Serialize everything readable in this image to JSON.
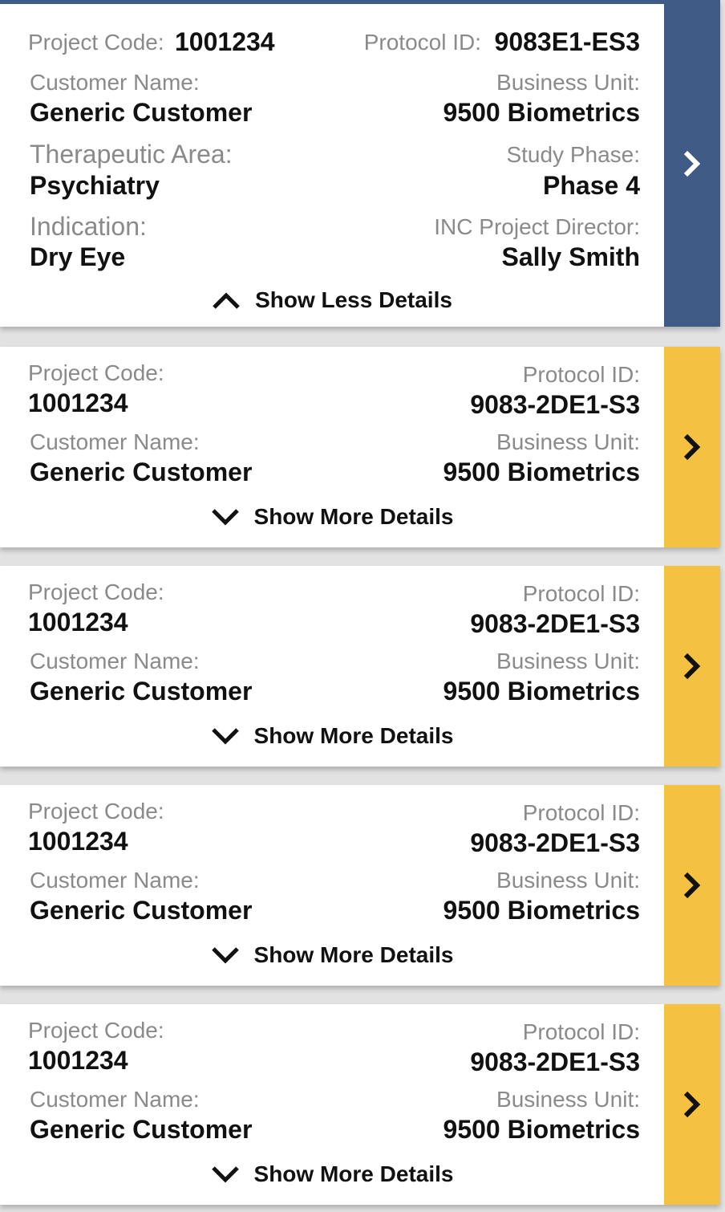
{
  "colors": {
    "expanded_accent": "#3f5a85",
    "collapsed_accent": "#f4c140"
  },
  "icons": {
    "open": "chevron-right-icon",
    "collapse": "chevron-up-icon",
    "expand": "chevron-down-icon"
  },
  "expanded_card": {
    "project_code_label": "Project Code:",
    "project_code": "1001234",
    "protocol_id_label": "Protocol ID:",
    "protocol_id": "9083E1-ES3",
    "customer_name_label": "Customer Name:",
    "customer_name": "Generic Customer",
    "business_unit_label": "Business Unit:",
    "business_unit": "9500 Biometrics",
    "therapeutic_area_label": "Therapeutic Area:",
    "therapeutic_area": "Psychiatry",
    "study_phase_label": "Study Phase:",
    "study_phase": "Phase 4",
    "indication_label": "Indication:",
    "indication": "Dry Eye",
    "project_director_label": "INC Project Director:",
    "project_director": "Sally Smith",
    "toggle_label": "Show Less Details"
  },
  "cards": [
    {
      "project_code_label": "Project Code:",
      "project_code": "1001234",
      "protocol_id_label": "Protocol ID:",
      "protocol_id": "9083-2DE1-S3",
      "customer_name_label": "Customer Name:",
      "customer_name": "Generic Customer",
      "business_unit_label": "Business Unit:",
      "business_unit": "9500 Biometrics",
      "toggle_label": "Show More Details"
    },
    {
      "project_code_label": "Project Code:",
      "project_code": "1001234",
      "protocol_id_label": "Protocol ID:",
      "protocol_id": "9083-2DE1-S3",
      "customer_name_label": "Customer Name:",
      "customer_name": "Generic Customer",
      "business_unit_label": "Business Unit:",
      "business_unit": "9500 Biometrics",
      "toggle_label": "Show More Details"
    },
    {
      "project_code_label": "Project Code:",
      "project_code": "1001234",
      "protocol_id_label": "Protocol ID:",
      "protocol_id": "9083-2DE1-S3",
      "customer_name_label": "Customer Name:",
      "customer_name": "Generic Customer",
      "business_unit_label": "Business Unit:",
      "business_unit": "9500 Biometrics",
      "toggle_label": "Show More Details"
    },
    {
      "project_code_label": "Project Code:",
      "project_code": "1001234",
      "protocol_id_label": "Protocol ID:",
      "protocol_id": "9083-2DE1-S3",
      "customer_name_label": "Customer Name:",
      "customer_name": "Generic Customer",
      "business_unit_label": "Business Unit:",
      "business_unit": "9500 Biometrics",
      "toggle_label": "Show More Details"
    }
  ]
}
